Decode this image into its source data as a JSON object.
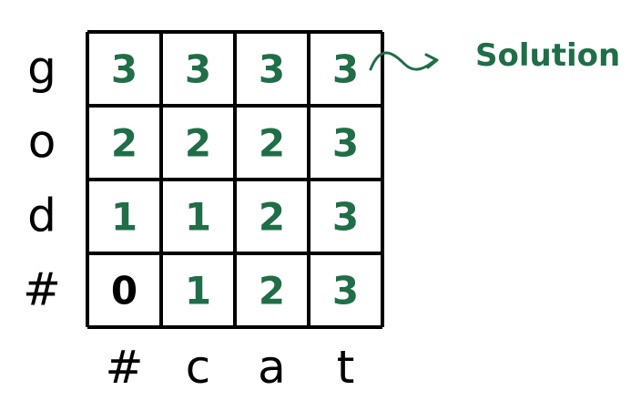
{
  "grid": {
    "row_labels": [
      "g",
      "o",
      "d",
      "#"
    ],
    "col_labels": [
      "#",
      "c",
      "a",
      "t"
    ],
    "cells": [
      [
        "3",
        "3",
        "3",
        "3"
      ],
      [
        "2",
        "2",
        "2",
        "3"
      ],
      [
        "1",
        "1",
        "2",
        "3"
      ],
      [
        "0",
        "1",
        "2",
        "3"
      ]
    ],
    "black_cells": [
      [
        3,
        0
      ]
    ]
  },
  "annotation": {
    "label": "Solution"
  },
  "colors": {
    "ink": "#000000",
    "green": "#1f6e47",
    "background": "#ffffff"
  }
}
